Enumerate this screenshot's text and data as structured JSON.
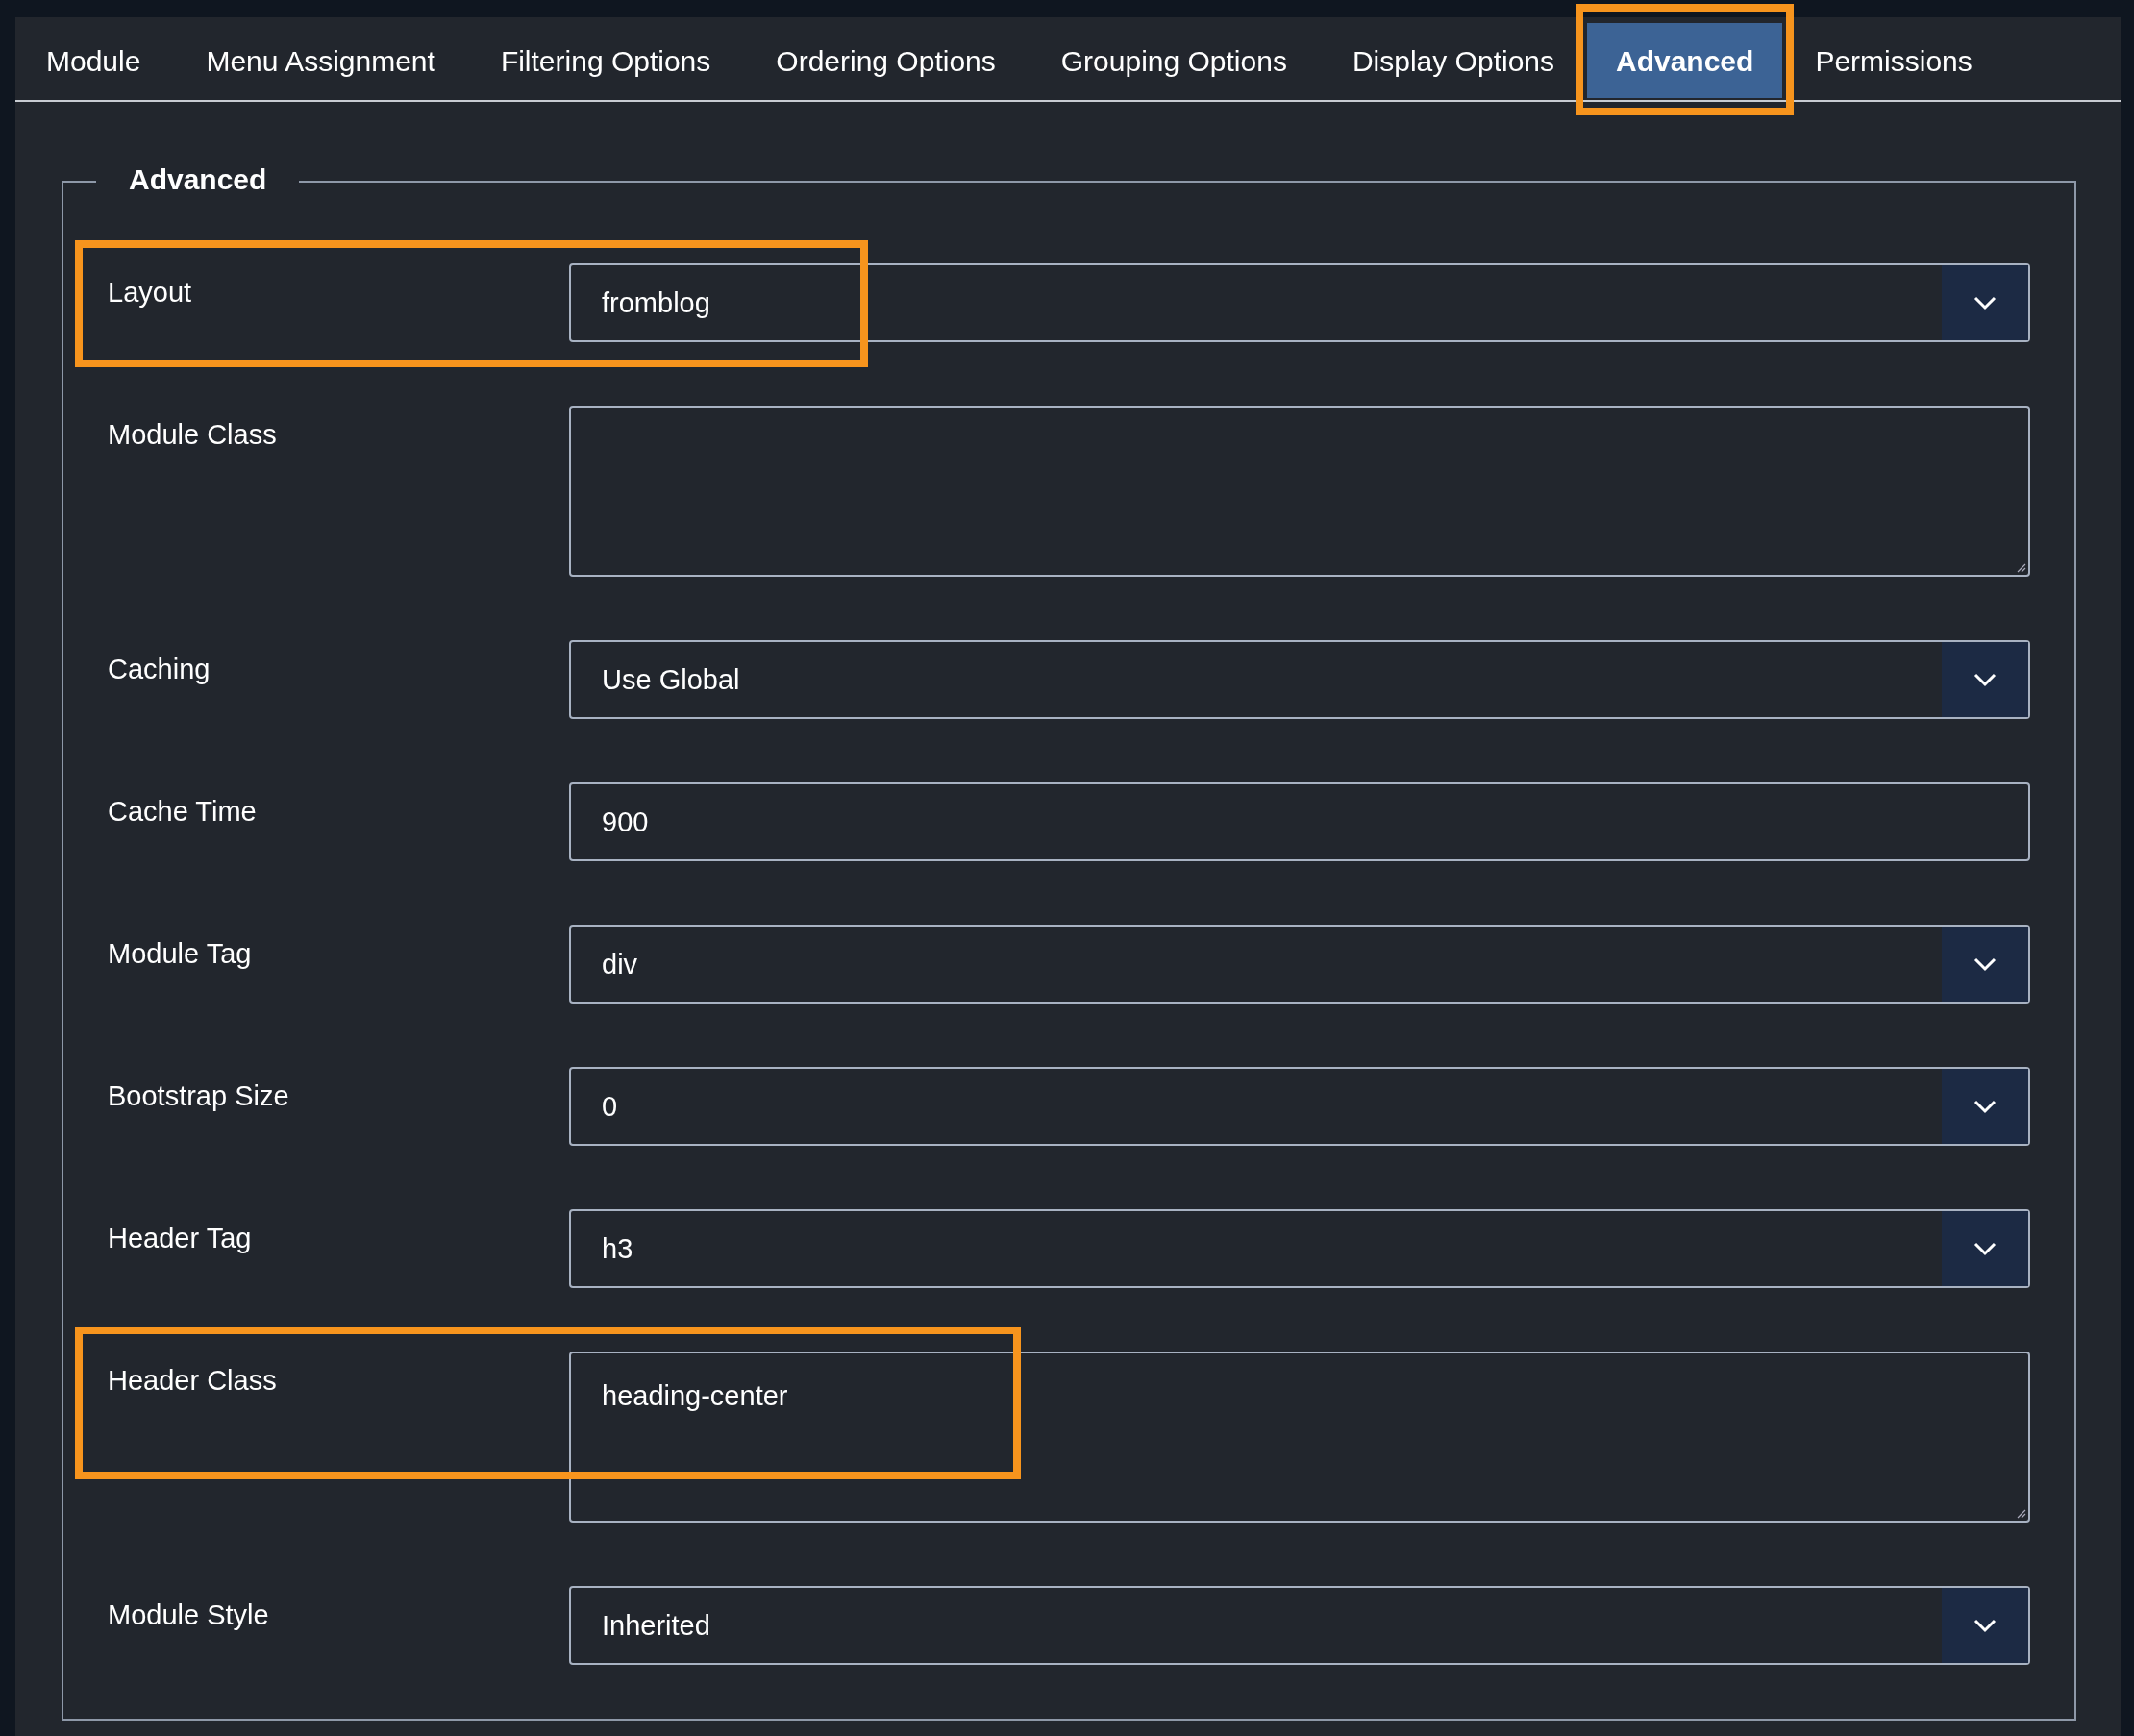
{
  "tabs": [
    {
      "label": "Module",
      "selected": false,
      "highlighted": false
    },
    {
      "label": "Menu Assignment",
      "selected": false,
      "highlighted": false
    },
    {
      "label": "Filtering Options",
      "selected": false,
      "highlighted": false
    },
    {
      "label": "Ordering Options",
      "selected": false,
      "highlighted": false
    },
    {
      "label": "Grouping Options",
      "selected": false,
      "highlighted": false
    },
    {
      "label": "Display Options",
      "selected": false,
      "highlighted": false
    },
    {
      "label": "Advanced",
      "selected": true,
      "highlighted": true
    },
    {
      "label": "Permissions",
      "selected": false,
      "highlighted": false
    }
  ],
  "fieldset": {
    "legend": "Advanced",
    "fields": [
      {
        "label": "Layout",
        "kind": "select",
        "value": "fromblog",
        "highlighted": true
      },
      {
        "label": "Module Class",
        "kind": "textarea",
        "highlighted": false
      },
      {
        "label": "Caching",
        "kind": "select",
        "value": "Use Global",
        "highlighted": false
      },
      {
        "label": "Cache Time",
        "kind": "text",
        "value": "900",
        "highlighted": false
      },
      {
        "label": "Module Tag",
        "kind": "select",
        "value": "div",
        "highlighted": false
      },
      {
        "label": "Bootstrap Size",
        "kind": "select",
        "value": "0",
        "highlighted": false
      },
      {
        "label": "Header Tag",
        "kind": "select",
        "value": "h3",
        "highlighted": false
      },
      {
        "label": "Header Class",
        "kind": "textarea",
        "value": "heading-center",
        "highlighted": true
      },
      {
        "label": "Module Style",
        "kind": "select",
        "value": "Inherited",
        "highlighted": false
      }
    ]
  }
}
